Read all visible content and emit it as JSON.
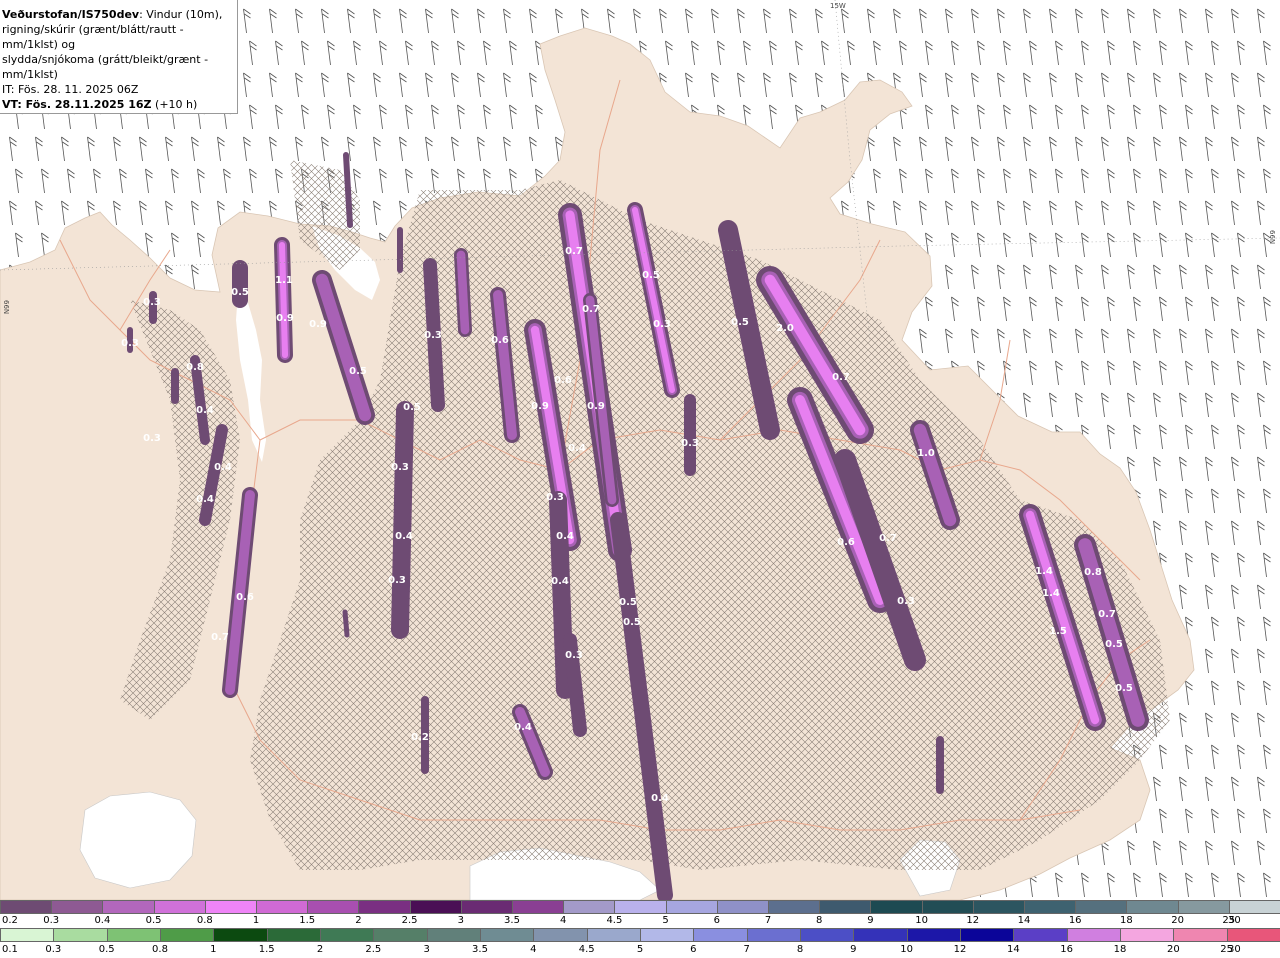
{
  "header": {
    "title": "Veðurstofan/IS750dev",
    "desc_line1": ": Vindur (10m),",
    "desc_line2": "rigning/skúrir (grænt/blátt/rautt - mm/1klst) og",
    "desc_line3": "slydda/snjókoma (grátt/bleikt/grænt - mm/1klst)",
    "it_line": "IT: Fös. 28. 11. 2025 06Z",
    "vt_label": "VT: Fös. 28.11.2025 16Z",
    "vt_offset": "(+10 h)"
  },
  "grid_labels": {
    "top_meridian": "15W",
    "right_parallel": "66N",
    "left_parallel": "66N"
  },
  "colors": {
    "land": "#f3e4d6",
    "sea": "#ffffff",
    "roads": "#e8a78c",
    "hatch": "#8a8076",
    "precip_dark": "#6e4b73",
    "precip_mid": "#a861b5",
    "precip_bright": "#e77ff0"
  },
  "precip_labels": [
    {
      "v": "0.3"
    },
    {
      "v": "0.5"
    },
    {
      "v": "1.1"
    },
    {
      "v": "0.9"
    },
    {
      "v": "0.9"
    },
    {
      "v": "0.3"
    },
    {
      "v": "0.5"
    },
    {
      "v": "0.3"
    },
    {
      "v": "0.4"
    },
    {
      "v": "0.5"
    },
    {
      "v": "0.4"
    },
    {
      "v": "0.3"
    },
    {
      "v": "0.6"
    },
    {
      "v": "0.8"
    },
    {
      "v": "0.7"
    },
    {
      "v": "0.4"
    },
    {
      "v": "0.3"
    },
    {
      "v": "0.2"
    },
    {
      "v": "0.4"
    },
    {
      "v": "0.3"
    },
    {
      "v": "0.6"
    },
    {
      "v": "0.7"
    },
    {
      "v": "0.6"
    },
    {
      "v": "0.9"
    },
    {
      "v": "0.4"
    },
    {
      "v": "0.9"
    },
    {
      "v": "0.7"
    },
    {
      "v": "0.5"
    },
    {
      "v": "0.3"
    },
    {
      "v": "0.5"
    },
    {
      "v": "2.0"
    },
    {
      "v": "0.7"
    },
    {
      "v": "1.0"
    },
    {
      "v": "0.6"
    },
    {
      "v": "0.7"
    },
    {
      "v": "0.3"
    },
    {
      "v": "0.3"
    },
    {
      "v": "0.4"
    },
    {
      "v": "0.4"
    },
    {
      "v": "0.5"
    },
    {
      "v": "0.5"
    },
    {
      "v": "0.3"
    },
    {
      "v": "0.4"
    },
    {
      "v": "0.4"
    },
    {
      "v": "1.4"
    },
    {
      "v": "1.4"
    },
    {
      "v": "1.5"
    },
    {
      "v": "0.8"
    },
    {
      "v": "0.7"
    },
    {
      "v": "0.5"
    },
    {
      "v": "0.5"
    },
    {
      "v": "0.3"
    }
  ],
  "legend_top": {
    "labels": [
      "0.2",
      "0.3",
      "0.4",
      "0.5",
      "0.8",
      "1",
      "1.5",
      "2",
      "2.5",
      "3",
      "3.5",
      "4",
      "4.5",
      "5",
      "6",
      "7",
      "8",
      "9",
      "10",
      "12",
      "14",
      "16",
      "18",
      "20",
      "25",
      "30"
    ],
    "colors": [
      "#6e4b73",
      "#8e5a93",
      "#b267bc",
      "#d071d9",
      "#ef84f7",
      "#d06ad4",
      "#a84fb0",
      "#7a2f82",
      "#4a0f55",
      "#6a2b73",
      "#8a3f93",
      "#a39ac9",
      "#b9b1ec",
      "#a6a6e0",
      "#8f91c8",
      "#5c6f8e",
      "#3e5a6e",
      "#1d4a52",
      "#224d55",
      "#2c5560",
      "#3e6270",
      "#55707e",
      "#6f8891",
      "#86999f",
      "#c8d2d5"
    ]
  },
  "legend_bottom": {
    "labels": [
      "0.1",
      "0.3",
      "0.5",
      "0.8",
      "1",
      "1.5",
      "2",
      "2.5",
      "3",
      "3.5",
      "4",
      "4.5",
      "5",
      "6",
      "7",
      "8",
      "9",
      "10",
      "12",
      "14",
      "16",
      "18",
      "20",
      "25",
      "30"
    ],
    "colors": [
      "#d9f5d4",
      "#a9dca0",
      "#7ec274",
      "#4f9c48",
      "#0c4a10",
      "#2b6a38",
      "#3f7a55",
      "#557f68",
      "#61807a",
      "#6f8c93",
      "#8293ad",
      "#9aa8cc",
      "#b2b8e8",
      "#8a8fe0",
      "#6b6fd0",
      "#4c4fc6",
      "#3432b9",
      "#1c17a8",
      "#0b0599",
      "#5b3fc6",
      "#d07fe0",
      "#f4a6e0",
      "#ef86b0",
      "#e8567a",
      "#e6262f"
    ]
  }
}
